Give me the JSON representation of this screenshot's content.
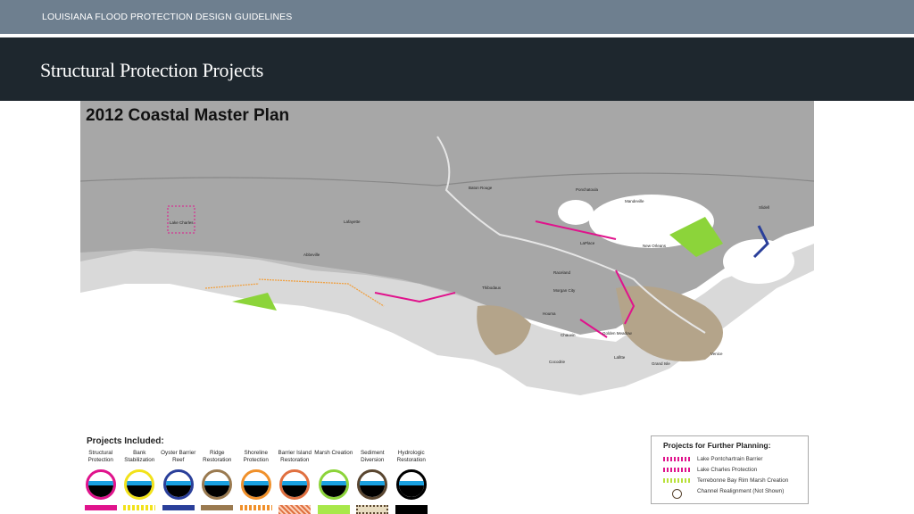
{
  "header": {
    "deck_title": "LOUISIANA FLOOD PROTECTION DESIGN GUIDELINES",
    "slide_title": "Structural Protection Projects"
  },
  "map": {
    "title": "2012 Coastal Master Plan",
    "places": [
      "Lake Charles",
      "Lafayette",
      "Baton Rouge",
      "Ponchatoula",
      "Mandeville",
      "Slidell",
      "Houma",
      "Thibodaux",
      "Morgan City",
      "Abbeville",
      "New Orleans",
      "LaPlace",
      "Raceland",
      "Lafitte",
      "Grand Isle",
      "Cocodrie",
      "Chauvin",
      "Golden Meadow",
      "Venice",
      "Hammond",
      "Crowley",
      "Covington",
      "Intracoastal City",
      "Jeanerette",
      "Erath"
    ]
  },
  "legend": {
    "title": "Projects Included:",
    "items": [
      {
        "label": "Structural Protection",
        "color": "#e0138c"
      },
      {
        "label": "Bank Stabilization",
        "color": "#f2e21a"
      },
      {
        "label": "Oyster Barrier Reef",
        "color": "#2a3f9a"
      },
      {
        "label": "Ridge Restoration",
        "color": "#9a7a50"
      },
      {
        "label": "Shoreline Protection",
        "color": "#f0902a"
      },
      {
        "label": "Barrier Island Restoration",
        "color": "#e07040"
      },
      {
        "label": "Marsh Creation",
        "color": "#8cd43a"
      },
      {
        "label": "Sediment Diversion",
        "color": "#5a4630"
      },
      {
        "label": "Hydrologic Restoration",
        "color": "#000000"
      }
    ]
  },
  "planning": {
    "title": "Projects for Further Planning:",
    "items": [
      {
        "label": "Lake Pontchartrain Barrier",
        "color": "#e0138c"
      },
      {
        "label": "Lake Charles Protection",
        "color": "#e0138c"
      },
      {
        "label": "Terrebonne Bay Rim Marsh Creation",
        "color": "#b8e03a"
      },
      {
        "label": "Channel Realignment (Not Shown)",
        "color": "#5a4630"
      }
    ]
  }
}
